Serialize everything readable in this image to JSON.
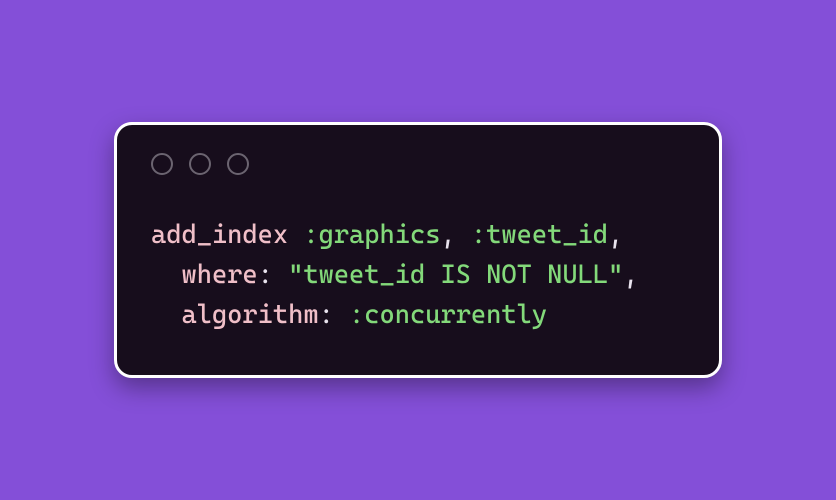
{
  "code": {
    "line1": {
      "method": "add_index",
      "sp1": " ",
      "sym1_colon": ":",
      "sym1": "graphics",
      "comma1": ",",
      "sp2": " ",
      "sym2_colon": ":",
      "sym2": "tweet_id",
      "comma2": ","
    },
    "line2": {
      "indent": "  ",
      "key": "where",
      "key_colon": ":",
      "sp": " ",
      "string": "\"tweet_id IS NOT NULL\"",
      "comma": ","
    },
    "line3": {
      "indent": "  ",
      "key": "algorithm",
      "key_colon": ":",
      "sp": " ",
      "sym_colon": ":",
      "sym": "concurrently"
    }
  }
}
